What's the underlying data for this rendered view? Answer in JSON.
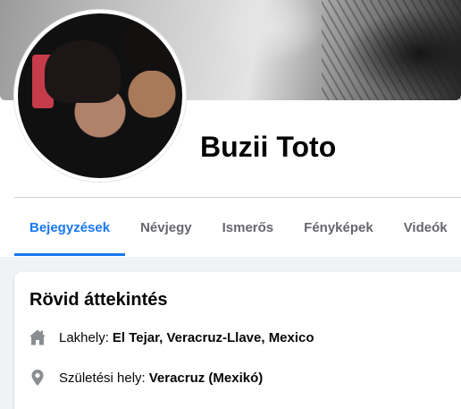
{
  "profile": {
    "name": "Buzii Toto"
  },
  "tabs": [
    {
      "label": "Bejegyzések",
      "active": true
    },
    {
      "label": "Névjegy",
      "active": false
    },
    {
      "label": "Ismerős",
      "active": false
    },
    {
      "label": "Fényképek",
      "active": false
    },
    {
      "label": "Videók",
      "active": false
    }
  ],
  "intro": {
    "title": "Rövid áttekintés",
    "items": [
      {
        "icon": "home-icon",
        "label": "Lakhely:",
        "value": "El Tejar, Veracruz-Llave, Mexico"
      },
      {
        "icon": "location-pin-icon",
        "label": "Születési hely:",
        "value": "Veracruz (Mexikó)"
      }
    ]
  },
  "colors": {
    "accent": "#1877f2",
    "text": "#050505",
    "muted": "#65676b",
    "background": "#f0f2f5",
    "icon": "#8a8d91"
  }
}
